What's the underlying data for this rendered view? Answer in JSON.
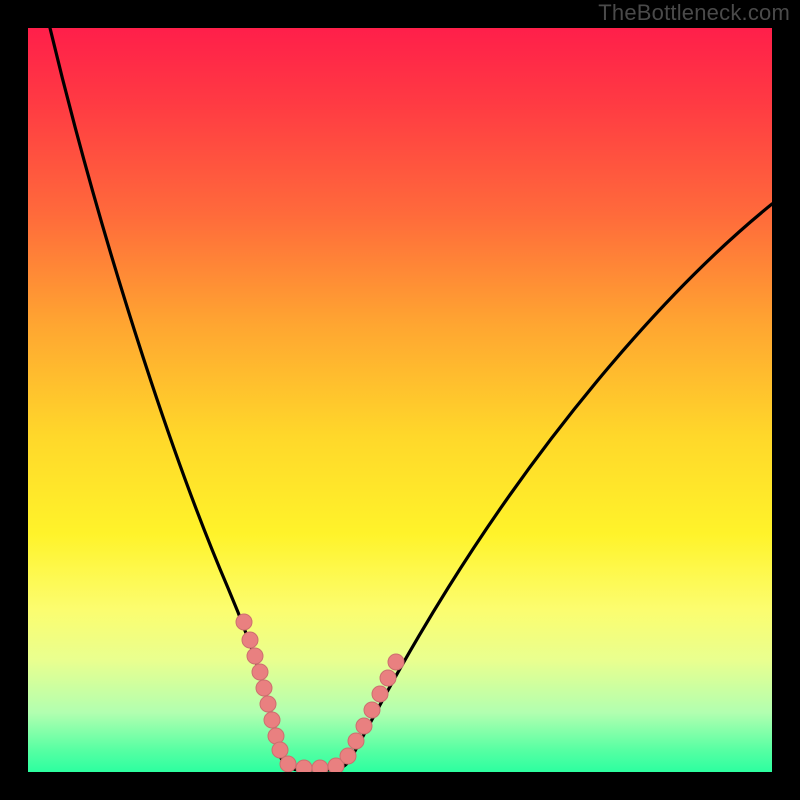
{
  "watermark": "TheBottleneck.com",
  "chart_data": {
    "type": "line",
    "title": "",
    "xlabel": "",
    "ylabel": "",
    "xlim": [
      0,
      100
    ],
    "ylim": [
      0,
      100
    ],
    "series": [
      {
        "name": "bottleneck-curve",
        "x": [
          3,
          5,
          10,
          15,
          20,
          25,
          28,
          30,
          32,
          33,
          35,
          37,
          40,
          42,
          45,
          50,
          55,
          60,
          65,
          70,
          75,
          80,
          85,
          90,
          95,
          100
        ],
        "values": [
          100,
          93,
          76,
          62,
          49,
          36,
          27,
          20,
          12,
          6,
          2,
          0,
          0,
          2,
          6,
          13,
          21,
          29,
          37,
          44,
          51,
          57,
          63,
          68,
          72,
          76
        ]
      }
    ],
    "annotations": [
      {
        "name": "left-beads",
        "x_from": 28.5,
        "x_to": 33.0,
        "y_from": 25,
        "y_to": 3
      },
      {
        "name": "right-beads",
        "x_from": 42.0,
        "x_to": 46.5,
        "y_from": 3,
        "y_to": 9
      },
      {
        "name": "flat-base",
        "x_from": 33.0,
        "x_to": 42.0,
        "y": 0
      }
    ],
    "background_gradient": [
      "#ff1f4a",
      "#ff6a3b",
      "#ffd82a",
      "#fff32a",
      "#58ffa3",
      "#2cffa0"
    ]
  }
}
